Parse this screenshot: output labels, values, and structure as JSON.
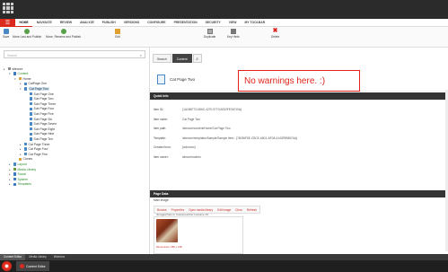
{
  "ribbon_tabs": [
    "HOME",
    "NAVIGATE",
    "REVIEW",
    "ANALYZE",
    "PUBLISH",
    "VERSIONS",
    "CONFIGURE",
    "PRESENTATION",
    "SECURITY",
    "VIEW",
    "MY TOOLBAR"
  ],
  "ribbon": {
    "save": "Save",
    "move_last_publish": "Move Last and Publish",
    "move_rename_publish": "Move, Rename and Publish",
    "edit": "Edit",
    "sample_item": "Sample Item",
    "folder": "Folder",
    "of1": "1 of 1",
    "of2": "2 of 1",
    "duplicate": "Duplicate",
    "copy_to": "Copy to",
    "key_hints": "Key Hints",
    "move_to": "Move to",
    "delete": "Delete",
    "rename": "Rename",
    "display_name": "Display name",
    "up": "Up",
    "first": "First",
    "down": "Down",
    "last": "Last",
    "groups": [
      "Write",
      "",
      "Edit",
      "Insert",
      "",
      "Operations",
      "Rename",
      "Sorting"
    ]
  },
  "search": {
    "placeholder": "Search"
  },
  "tree": [
    {
      "label": "sitecore",
      "indent": 0,
      "arrow": "▸",
      "color": "#8a8a8a"
    },
    {
      "label": "Content",
      "indent": 1,
      "arrow": "▾",
      "color": "#3b7bbf",
      "green": true
    },
    {
      "label": "Home",
      "indent": 2,
      "arrow": "▾",
      "color": "#d9a23a"
    },
    {
      "label": "CatPage One",
      "indent": 3,
      "arrow": "▸",
      "color": "#4a88c5"
    },
    {
      "label": "Cat Page Two",
      "indent": 3,
      "arrow": "▾",
      "color": "#4a88c5",
      "selected": true
    },
    {
      "label": "Sub Page One",
      "indent": 4,
      "arrow": "",
      "color": "#4a88c5"
    },
    {
      "label": "Sub Page Two",
      "indent": 4,
      "arrow": "",
      "color": "#4a88c5"
    },
    {
      "label": "Sub Page Three",
      "indent": 4,
      "arrow": "",
      "color": "#4a88c5"
    },
    {
      "label": "Sub Page Four",
      "indent": 4,
      "arrow": "",
      "color": "#4a88c5"
    },
    {
      "label": "Sub Page Five",
      "indent": 4,
      "arrow": "",
      "color": "#4a88c5"
    },
    {
      "label": "Sub Page Six",
      "indent": 4,
      "arrow": "",
      "color": "#4a88c5"
    },
    {
      "label": "Sub Page Seven",
      "indent": 4,
      "arrow": "",
      "color": "#4a88c5"
    },
    {
      "label": "Sub Page Eight",
      "indent": 4,
      "arrow": "",
      "color": "#4a88c5"
    },
    {
      "label": "Sub Page Nine",
      "indent": 4,
      "arrow": "",
      "color": "#4a88c5"
    },
    {
      "label": "Sub Page Ten",
      "indent": 4,
      "arrow": "",
      "color": "#4a88c5"
    },
    {
      "label": "Cat Page Three",
      "indent": 3,
      "arrow": "▸",
      "color": "#4a88c5"
    },
    {
      "label": "Cat Page Four",
      "indent": 3,
      "arrow": "▸",
      "color": "#4a88c5"
    },
    {
      "label": "Cat Page Five",
      "indent": 3,
      "arrow": "▸",
      "color": "#4a88c5"
    },
    {
      "label": "Clones",
      "indent": 2,
      "arrow": "",
      "color": "#d9a23a"
    },
    {
      "label": "Layout",
      "indent": 1,
      "arrow": "▸",
      "color": "#4a88c5",
      "green": true
    },
    {
      "label": "Media Library",
      "indent": 1,
      "arrow": "▸",
      "color": "#6a9c3a",
      "green": true
    },
    {
      "label": "Social",
      "indent": 1,
      "arrow": "▸",
      "color": "#3b7bbf",
      "green": true
    },
    {
      "label": "System",
      "indent": 1,
      "arrow": "▸",
      "color": "#3b7bbf",
      "green": true
    },
    {
      "label": "Templates",
      "indent": 1,
      "arrow": "▸",
      "color": "#3b7bbf",
      "green": true
    }
  ],
  "content_tabs": {
    "search": "Search",
    "content": "Content"
  },
  "item": {
    "title": "Cat Page Two"
  },
  "callout": "No warnings here. :)",
  "quick_info": {
    "header": "Quick Info",
    "rows": [
      {
        "label": "Item ID:",
        "value": "{1A1B8773-6D6C-4270-9770-B232FE06710A}"
      },
      {
        "label": "Item name:",
        "value": "Cat Page Two"
      },
      {
        "label": "Item path:",
        "value": "/sitecore/content/Home/Cat Page Two"
      },
      {
        "label": "Template:",
        "value": "/sitecore/templates/Sample/Sample Item - {76036F5E-CBCE-46D1-AF0A-4143F9B557AA}"
      },
      {
        "label": "Created from:",
        "value": "[unknown]"
      },
      {
        "label": "Item owner:",
        "value": "sitecore\\admin"
      }
    ]
  },
  "page_data": {
    "header": "Page Data",
    "main_image": "Main image:",
    "links": [
      "Browse",
      "Properties",
      "Open media library",
      "Edit image",
      "Clear",
      "Refresh"
    ],
    "image_path": "/Images/Cats In Costumes/Cat Costume 19",
    "caption": "Dimensions: 350 x 138"
  },
  "bottom_tabs": [
    "Content Editor",
    "Media Library",
    "Workbox"
  ],
  "taskbar": {
    "item": "Content Editor"
  }
}
